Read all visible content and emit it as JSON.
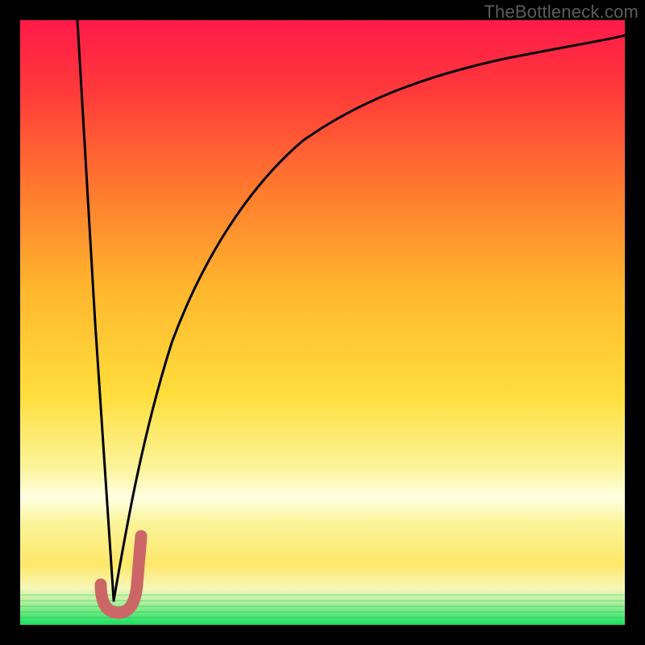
{
  "watermark": "TheBottleneck.com",
  "colors": {
    "frame": "#000000",
    "curve": "#000000",
    "marker": "#CC6666",
    "gradient_top": "#FF1A49",
    "gradient_mid_orange": "#FF8A2A",
    "gradient_yellow": "#FFE344",
    "gradient_pale_yellow": "#FCFCA0",
    "gradient_green": "#18E060"
  },
  "chart_data": {
    "type": "line",
    "title": "",
    "xlabel": "",
    "ylabel": "",
    "xlim": [
      0,
      100
    ],
    "ylim": [
      0,
      100
    ],
    "series": [
      {
        "name": "left-descent",
        "x": [
          9.5,
          12.5,
          15.5
        ],
        "values": [
          100,
          50,
          4
        ]
      },
      {
        "name": "right-curve",
        "x": [
          15.5,
          17,
          20,
          25,
          30,
          35,
          40,
          50,
          60,
          70,
          80,
          90,
          100
        ],
        "values": [
          4,
          9,
          27,
          47,
          60,
          69,
          75,
          83,
          88.5,
          92,
          94.5,
          96.3,
          97.5
        ]
      }
    ],
    "marker": {
      "name": "J-marker",
      "shape": "J",
      "approx_x_range": [
        13.5,
        19.5
      ],
      "approx_y_range": [
        2,
        15
      ],
      "vertex_x": 16,
      "vertex_y": 2
    },
    "background": {
      "type": "vertical-gradient",
      "stops": [
        {
          "pos": 0.0,
          "color": "#FF1A49"
        },
        {
          "pos": 0.25,
          "color": "#FF6A30"
        },
        {
          "pos": 0.5,
          "color": "#FFC130"
        },
        {
          "pos": 0.68,
          "color": "#FFE344"
        },
        {
          "pos": 0.78,
          "color": "#FCFCA0"
        },
        {
          "pos": 0.82,
          "color": "#FFE344"
        },
        {
          "pos": 0.97,
          "color": "#FFF7A8"
        },
        {
          "pos": 1.0,
          "color": "#18E060"
        }
      ]
    },
    "green_band_lines_y_pct": [
      95.2,
      96.1,
      97.0,
      97.9,
      98.8
    ]
  }
}
